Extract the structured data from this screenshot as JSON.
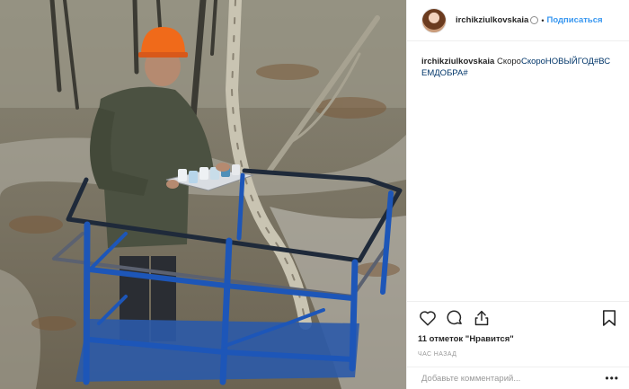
{
  "header": {
    "username": "irchikziulkovskaia",
    "separator": "•",
    "follow_label": "Подписаться"
  },
  "caption": {
    "author": "irchikziulkovskaia",
    "text": "Скоро",
    "hashtag": "СкороНОВЫЙГОД#ВСЕМДОБРА#"
  },
  "actions": {
    "icons": [
      "heart-icon",
      "comment-icon",
      "share-icon",
      "bookmark-icon"
    ],
    "likes_label": "11 отметок \"Нравится\"",
    "time_label": "час назад"
  },
  "comment": {
    "placeholder": "Добавьте комментарий...",
    "more_label": "•••"
  },
  "colors": {
    "accent": "#3897f0",
    "hashtag": "#003569",
    "platform_blue": "#1c4fa8",
    "helmet_orange": "#f06a1a"
  }
}
